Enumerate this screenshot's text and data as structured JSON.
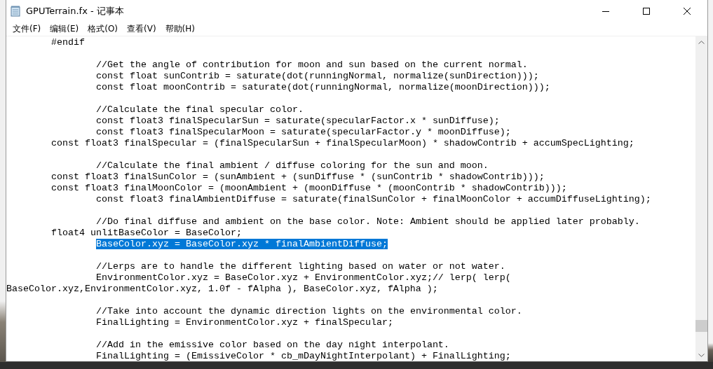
{
  "window": {
    "title": "GPUTerrain.fx - 记事本"
  },
  "menu": [
    {
      "label": "文件(F)"
    },
    {
      "label": "编辑(E)"
    },
    {
      "label": "格式(O)"
    },
    {
      "label": "查看(V)"
    },
    {
      "label": "帮助(H)"
    }
  ],
  "editor": {
    "blocks": [
      [
        {
          "text": "        #endif",
          "selected": false
        }
      ],
      [
        {
          "text": "                //Get the angle of contribution for moon and sun based on the current normal.",
          "selected": false
        },
        {
          "text": "                const float sunContrib = saturate(dot(runningNormal, normalize(sunDirection)));",
          "selected": false
        },
        {
          "text": "                const float moonContrib = saturate(dot(runningNormal, normalize(moonDirection)));",
          "selected": false
        }
      ],
      [
        {
          "text": "                //Calculate the final specular color.",
          "selected": false
        },
        {
          "text": "                const float3 finalSpecularSun = saturate(specularFactor.x * sunDiffuse);",
          "selected": false
        },
        {
          "text": "                const float3 finalSpecularMoon = saturate(specularFactor.y * moonDiffuse);",
          "selected": false
        },
        {
          "text": "        const float3 finalSpecular = (finalSpecularSun + finalSpecularMoon) * shadowContrib + accumSpecLighting;",
          "selected": false
        }
      ],
      [
        {
          "text": "                //Calculate the final ambient / diffuse coloring for the sun and moon.",
          "selected": false
        },
        {
          "text": "        const float3 finalSunColor = (sunAmbient + (sunDiffuse * (sunContrib * shadowContrib)));",
          "selected": false
        },
        {
          "text": "        const float3 finalMoonColor = (moonAmbient + (moonDiffuse * (moonContrib * shadowContrib)));",
          "selected": false
        },
        {
          "text": "                const float3 finalAmbientDiffuse = saturate(finalSunColor + finalMoonColor + accumDiffuseLighting);",
          "selected": false
        }
      ],
      [
        {
          "text": "                //Do final diffuse and ambient on the base color. Note: Ambient should be applied later probably.",
          "selected": false
        },
        {
          "text": "        float4 unlitBaseColor = BaseColor;",
          "selected": false
        },
        {
          "text": "                BaseColor.xyz = BaseColor.xyz * finalAmbientDiffuse;",
          "selected": true
        }
      ],
      [
        {
          "text": "                //Lerps are to handle the different lighting based on water or not water.",
          "selected": false
        },
        {
          "text": "                EnvironmentColor.xyz = BaseColor.xyz + EnvironmentColor.xyz;// lerp( lerp(",
          "selected": false
        },
        {
          "text": "BaseColor.xyz,EnvironmentColor.xyz, 1.0f - fAlpha ), BaseColor.xyz, fAlpha );",
          "selected": false
        }
      ],
      [
        {
          "text": "                //Take into account the dynamic direction lights on the environmental color.",
          "selected": false
        },
        {
          "text": "                FinalLighting = EnvironmentColor.xyz + finalSpecular;",
          "selected": false
        }
      ],
      [
        {
          "text": "                //Add in the emissive color based on the day night interpolant.",
          "selected": false
        },
        {
          "text": "                FinalLighting = (EmissiveColor * cb_mDayNightInterpolant) + FinalLighting;",
          "selected": false
        }
      ]
    ]
  }
}
